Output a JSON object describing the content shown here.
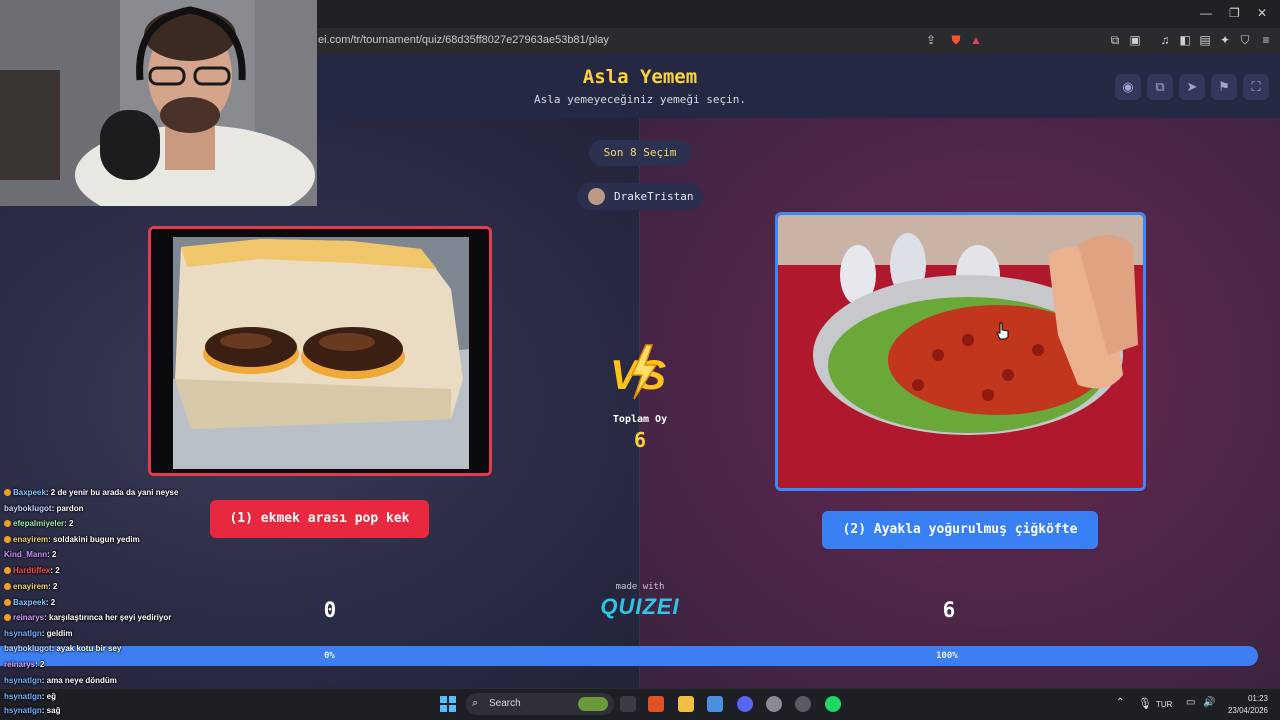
{
  "browser": {
    "url": "ei.com/tr/tournament/quiz/68d35ff8027e27963ae53b81/play",
    "window_controls": [
      "—",
      "❐",
      "✕"
    ]
  },
  "quiz": {
    "title": "Asla Yemem",
    "subtitle": "Asla yemeyeceğiniz yemeği seçin.",
    "round_label": "Son 8 Seçim",
    "player_name": "DrakeTristan",
    "header_icons": [
      "eye-icon",
      "copy-icon",
      "send-icon",
      "flag-icon",
      "fullscreen-icon"
    ]
  },
  "left_choice": {
    "label": "(1) ekmek arası pop kek",
    "votes": "0",
    "percent": "0%",
    "percent_value": 0
  },
  "right_choice": {
    "label": "(2) Ayakla yoğurulmuş çiğköfte",
    "votes": "6",
    "percent": "100%",
    "percent_value": 100
  },
  "total": {
    "label": "Toplam Oy",
    "value": "6"
  },
  "branding": {
    "made_with": "made with",
    "logo": "QUIZEI"
  },
  "chat": [
    {
      "user": "Baxpeek",
      "msg": ": 2 de yenir bu arada da yani neyse",
      "color": "#7ec8ff"
    },
    {
      "user": "bayboklugot",
      "msg": ": pardon",
      "color": "#c7d3ff"
    },
    {
      "user": "efepalmiyeler",
      "msg": ": 2",
      "color": "#9be7a6"
    },
    {
      "user": "enayirem",
      "msg": ": soldakini bugun yedim",
      "color": "#f2d36b"
    },
    {
      "user": "Kind_Mann",
      "msg": ": 2",
      "color": "#c48bff"
    },
    {
      "user": "Hardtiffex",
      "msg": ": 2",
      "color": "#ff4a4a"
    },
    {
      "user": "enayirem",
      "msg": ": 2",
      "color": "#f2d36b"
    },
    {
      "user": "Baxpeek",
      "msg": ": 2",
      "color": "#7ec8ff"
    },
    {
      "user": "reinarys",
      "msg": ": karşılaştırınca her şeyi yediriyor",
      "color": "#d59cff"
    },
    {
      "user": "hsynatlgn",
      "msg": ": geldim",
      "color": "#6fb2ff"
    },
    {
      "user": "bayboklugot",
      "msg": ": ayak kotu bir sey",
      "color": "#c7d3ff"
    },
    {
      "user": "reinarys",
      "msg": ": 2",
      "color": "#d59cff"
    },
    {
      "user": "hsynatlgn",
      "msg": ": ama neye döndüm",
      "color": "#6fb2ff"
    },
    {
      "user": "hsynatlgn",
      "msg": ": eğ",
      "color": "#6fb2ff"
    },
    {
      "user": "hsynatlgn",
      "msg": ": sağ",
      "color": "#6fb2ff"
    }
  ],
  "taskbar": {
    "search_label": "Search",
    "language": "TUR",
    "time": "01:23",
    "date": "23/04/2026"
  },
  "colors": {
    "accent_left": "#e8283f",
    "accent_right": "#3a80f5",
    "title_yellow": "#ffd23c"
  }
}
